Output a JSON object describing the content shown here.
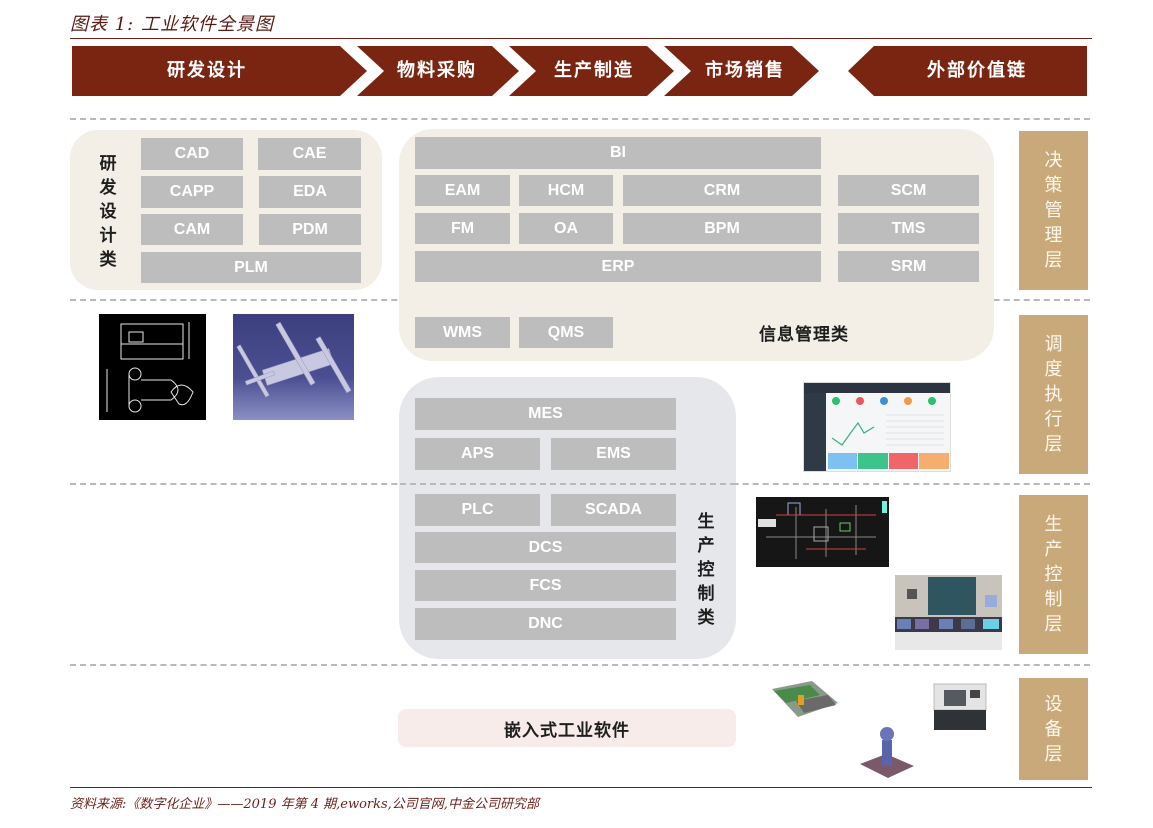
{
  "figure": {
    "title": "图表 1: 工业软件全景图",
    "source": "资料来源:《数字化企业》——2019 年第 4 期,eworks,公司官网,中金公司研究部"
  },
  "value_chain": {
    "stages": [
      "研发设计",
      "物料采购",
      "生产制造",
      "市场销售"
    ],
    "external": "外部价值链",
    "color": "#7a2412"
  },
  "layers": [
    {
      "label": "决策管理层"
    },
    {
      "label": "调度执行层"
    },
    {
      "label": "生产控制层"
    },
    {
      "label": "设备层"
    }
  ],
  "rd_design": {
    "label": "研发设计类",
    "items": [
      "CAD",
      "CAE",
      "CAPP",
      "EDA",
      "CAM",
      "PDM",
      "PLM"
    ]
  },
  "info_management": {
    "label": "信息管理类",
    "items": {
      "bi": "BI",
      "eam": "EAM",
      "hcm": "HCM",
      "crm": "CRM",
      "scm": "SCM",
      "fm": "FM",
      "oa": "OA",
      "bpm": "BPM",
      "tms": "TMS",
      "erp": "ERP",
      "srm": "SRM",
      "wms": "WMS",
      "qms": "QMS"
    }
  },
  "production_control": {
    "label": "生产控制类",
    "items": {
      "mes": "MES",
      "aps": "APS",
      "ems": "EMS",
      "plc": "PLC",
      "scada": "SCADA",
      "dcs": "DCS",
      "fcs": "FCS",
      "dnc": "DNC"
    }
  },
  "embedded": {
    "label": "嵌入式工业软件"
  },
  "images": [
    {
      "name": "cad-drawing"
    },
    {
      "name": "3d-model-render"
    },
    {
      "name": "dashboard-screenshot"
    },
    {
      "name": "scada-schematic"
    },
    {
      "name": "control-room-photo"
    },
    {
      "name": "circuit-board-photo"
    },
    {
      "name": "cnc-machine-photo"
    },
    {
      "name": "embedded-device-photo"
    }
  ],
  "colors": {
    "brand_dark_red": "#7a2412",
    "layer_tan": "#c9a97a",
    "box_grey": "#bdbdbd",
    "panel_beige": "#f3eee6",
    "panel_grey": "#e6e7eb",
    "panel_pink": "#f7ecea"
  }
}
